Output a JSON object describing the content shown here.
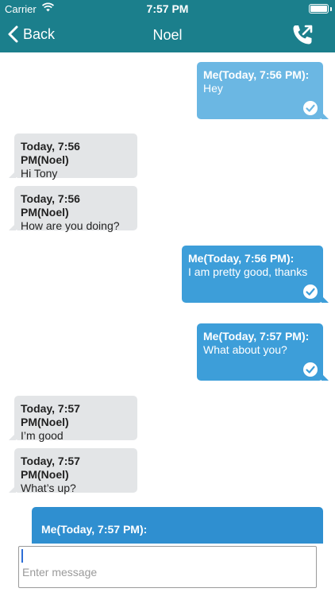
{
  "status": {
    "carrier": "Carrier",
    "time": "7:57 PM",
    "battery_level": 1.0
  },
  "nav": {
    "back_label": "Back",
    "title": "Noel",
    "call_icon": "phone-outgoing-icon"
  },
  "colors": {
    "header": "#1b7f8c",
    "incoming_bubble": "#e3e5e7"
  },
  "messages": [
    {
      "direction": "out",
      "meta": "Me(Today, 7:56 PM):",
      "text": "Hey",
      "delivered": true,
      "color": "#6bb7e3"
    },
    {
      "direction": "in",
      "meta": "Today, 7:56 PM(Noel)",
      "text": "Hi Tony"
    },
    {
      "direction": "in",
      "meta": "Today, 7:56 PM(Noel)",
      "text": "How are you doing?"
    },
    {
      "direction": "out",
      "meta": "Me(Today, 7:56 PM):",
      "text": "I am pretty good, thanks",
      "delivered": true,
      "color": "#3d9ed9"
    },
    {
      "direction": "out",
      "meta": "Me(Today, 7:57 PM):",
      "text": "What about you?",
      "delivered": true,
      "color": "#3d9ed9"
    },
    {
      "direction": "in",
      "meta": "Today, 7:57 PM(Noel)",
      "text": "I’m good"
    },
    {
      "direction": "in",
      "meta": "Today, 7:57 PM(Noel)",
      "text": "What’s up?"
    },
    {
      "direction": "out",
      "meta": "Me(Today, 7:57 PM):",
      "text": "",
      "delivered": false,
      "color": "#2f8fd0"
    }
  ],
  "composer": {
    "placeholder": "Enter message",
    "value": ""
  }
}
